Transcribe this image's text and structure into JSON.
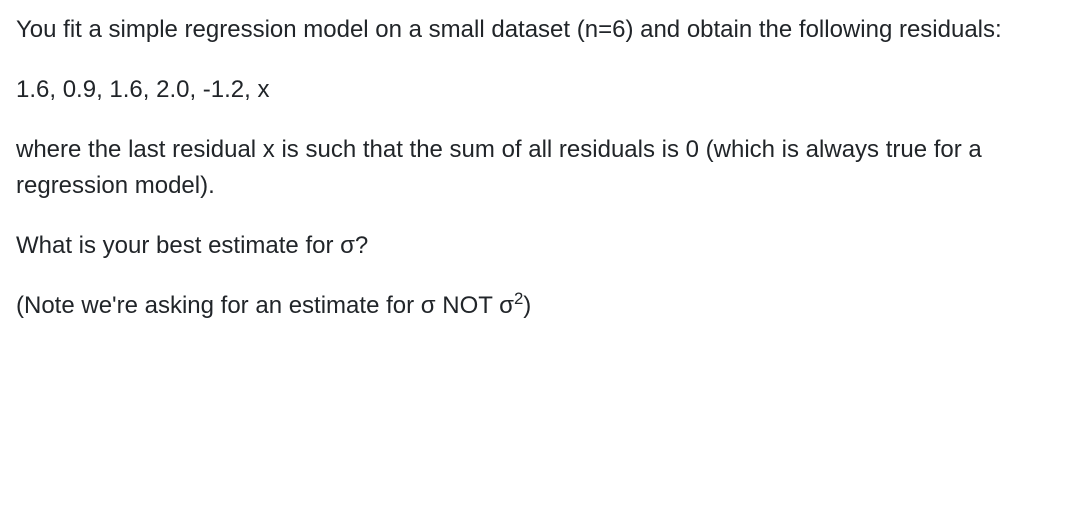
{
  "question": {
    "intro": "You fit a simple regression model on a small dataset (n=6) and obtain the following residuals:",
    "residuals": "1.6, 0.9, 1.6, 2.0, -1.2, x",
    "explanation": "where the last residual x is such that the sum of all residuals is 0 (which is always true for a regression model).",
    "prompt": "What is your best estimate for σ?",
    "note_prefix": "(Note we're asking for an estimate for σ NOT σ",
    "note_exponent": "2",
    "note_suffix": ")"
  }
}
